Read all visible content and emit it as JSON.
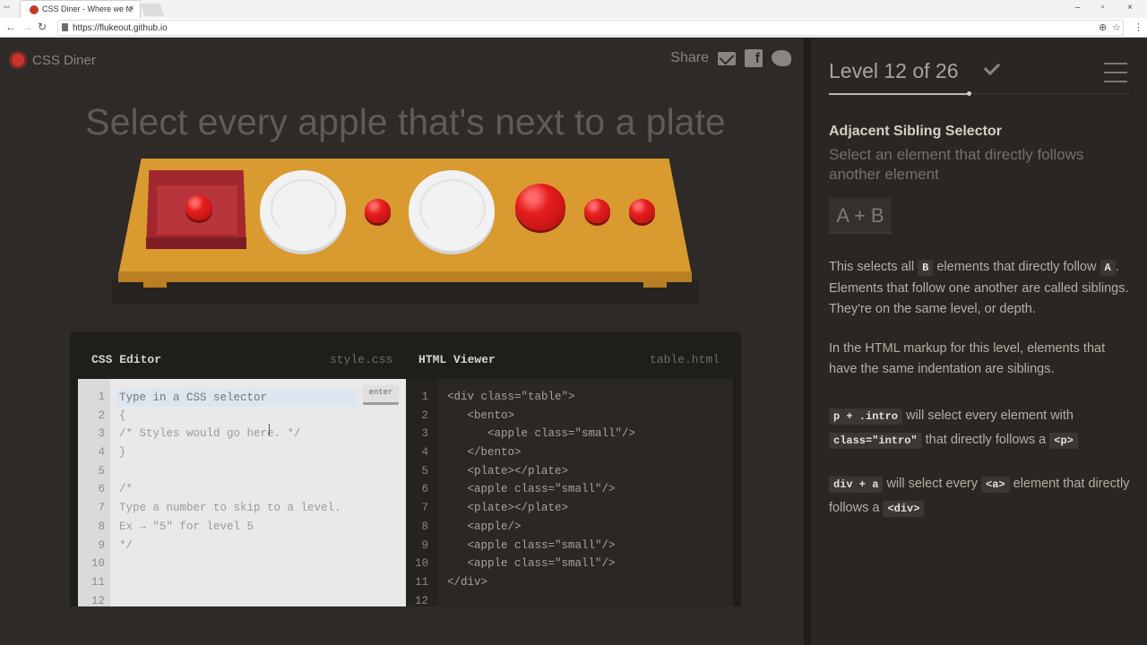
{
  "browser": {
    "tab_title": "CSS Diner - Where we fe",
    "tab_close": "×",
    "url": "https://flukeout.github.io",
    "back": "←",
    "forward": "→",
    "reload": "↻",
    "win_min": "–",
    "win_max": "▫",
    "win_close": "×",
    "zoom_icon": "⊕",
    "star_icon": "☆",
    "menu_icon": "⋮"
  },
  "header": {
    "logo_text": "CSS Diner",
    "share_label": "Share",
    "fb_glyph": "f"
  },
  "task": {
    "order": "Select every apple that's next to a plate"
  },
  "css_editor": {
    "title": "CSS Editor",
    "file": "style.css",
    "placeholder": "Type in a CSS selector",
    "enter_label": "enter",
    "line_numbers": [
      "1",
      "2",
      "3",
      "4",
      "5",
      "6",
      "7",
      "8",
      "9",
      "10",
      "11",
      "12"
    ],
    "lines": [
      "",
      "{",
      "/* Styles would go here. */",
      "}",
      "",
      "/*",
      "Type a number to skip to a level.",
      "Ex → \"5\" for level 5",
      "*/",
      "",
      "",
      ""
    ]
  },
  "html_viewer": {
    "title": "HTML Viewer",
    "file": "table.html",
    "line_numbers": [
      "1",
      "2",
      "3",
      "4",
      "5",
      "6",
      "7",
      "8",
      "9",
      "10",
      "11",
      "12"
    ],
    "lines": [
      "<div class=\"table\">",
      "   <bento>",
      "      <apple class=\"small\"/>",
      "   </bento>",
      "   <plate></plate>",
      "   <apple class=\"small\"/>",
      "   <plate></plate>",
      "   <apple/>",
      "   <apple class=\"small\"/>",
      "   <apple class=\"small\"/>",
      "</div>",
      ""
    ]
  },
  "sidebar": {
    "level_title": "Level 12 of 26",
    "progress": 0.46,
    "selector_name": "Adjacent Sibling Selector",
    "selector_title": "Select an element that directly follows another element",
    "syntax": "A + B",
    "desc_a": "This selects all ",
    "desc_b_code": "B",
    "desc_c": " elements that directly follow ",
    "desc_d_code": "A",
    "desc_e": ". Elements that follow one another are called siblings. They're on the same level, or depth.",
    "desc2": "In the HTML markup for this level, elements that have the same indentation are siblings.",
    "ex1_code": "p + .intro",
    "ex1_text": " will select every element with ",
    "ex1_code2": "class=\"intro\"",
    "ex1_text2": " that directly follows a ",
    "ex1_code3": "<p>",
    "ex2_code": "div + a",
    "ex2_text": " will select every ",
    "ex2_code2": "<a>",
    "ex2_text2": " element that directly follows a ",
    "ex2_code3": "<div>"
  },
  "colors": {
    "accent_red": "#c9342b",
    "table": "#d99a30",
    "bento": "#a3272e",
    "plate": "#f2f2f2",
    "apple": "#e61e1e"
  }
}
